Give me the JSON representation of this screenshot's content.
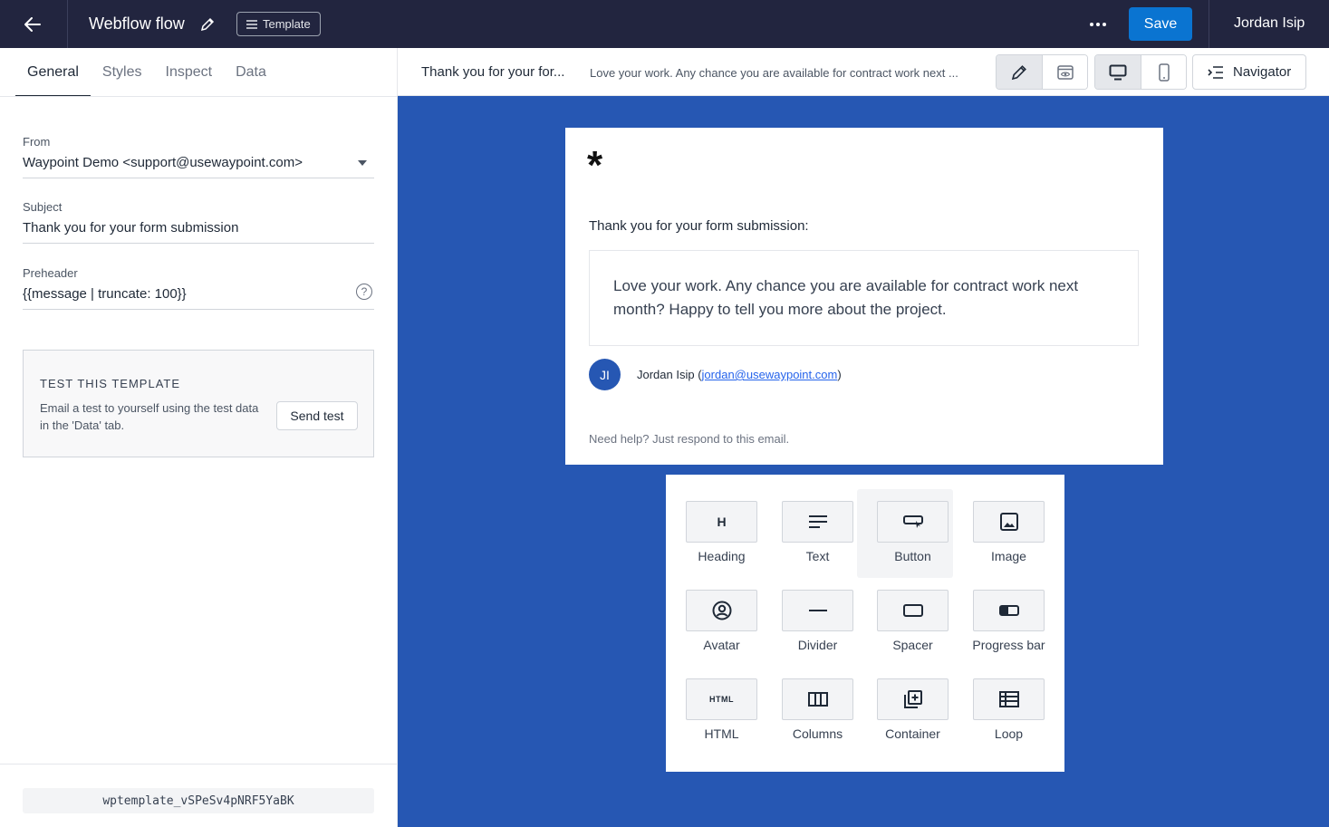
{
  "header": {
    "flow_title": "Webflow flow",
    "template_badge": "Template",
    "save_label": "Save",
    "user_name": "Jordan Isip"
  },
  "left_panel": {
    "tabs": [
      "General",
      "Styles",
      "Inspect",
      "Data"
    ],
    "active_tab": "General",
    "from": {
      "label": "From",
      "value": "Waypoint Demo <support@usewaypoint.com>"
    },
    "subject": {
      "label": "Subject",
      "value": "Thank you for your form submission"
    },
    "preheader": {
      "label": "Preheader",
      "value": "{{message | truncate: 100}}",
      "help_icon": "?"
    },
    "test_card": {
      "title": "TEST THIS TEMPLATE",
      "description": "Email a test to yourself using the test data in the 'Data' tab.",
      "button": "Send test"
    },
    "template_id": "wptemplate_vSPeSv4pNRF5YaBK"
  },
  "preview_bar": {
    "subject": "Thank you for your for...",
    "preheader": "Love your work. Any chance you are available for contract work next ...",
    "navigator_label": "Navigator"
  },
  "email": {
    "logo": "*",
    "intro": "Thank you for your form submission:",
    "message": "Love your work. Any chance you are available for contract work next month? Happy to tell you more about the project.",
    "avatar_initials": "JI",
    "sender_name": "Jordan Isip (",
    "sender_email": "jordan@usewaypoint.com",
    "sender_close": ")",
    "help": "Need help? Just respond to this email."
  },
  "palette": {
    "blocks": [
      {
        "label": "Heading",
        "icon": "heading-icon"
      },
      {
        "label": "Text",
        "icon": "text-icon"
      },
      {
        "label": "Button",
        "icon": "button-icon"
      },
      {
        "label": "Image",
        "icon": "image-icon"
      },
      {
        "label": "Avatar",
        "icon": "avatar-icon"
      },
      {
        "label": "Divider",
        "icon": "divider-icon"
      },
      {
        "label": "Spacer",
        "icon": "spacer-icon"
      },
      {
        "label": "Progress bar",
        "icon": "progress-bar-icon"
      },
      {
        "label": "HTML",
        "icon": "html-icon"
      },
      {
        "label": "Columns",
        "icon": "columns-icon"
      },
      {
        "label": "Container",
        "icon": "container-icon"
      },
      {
        "label": "Loop",
        "icon": "loop-icon"
      }
    ],
    "heading_glyph": "H",
    "html_glyph": "HTML"
  },
  "colors": {
    "topbar": "#22253f",
    "accent": "#0a74d1",
    "canvas": "#2657b3"
  }
}
